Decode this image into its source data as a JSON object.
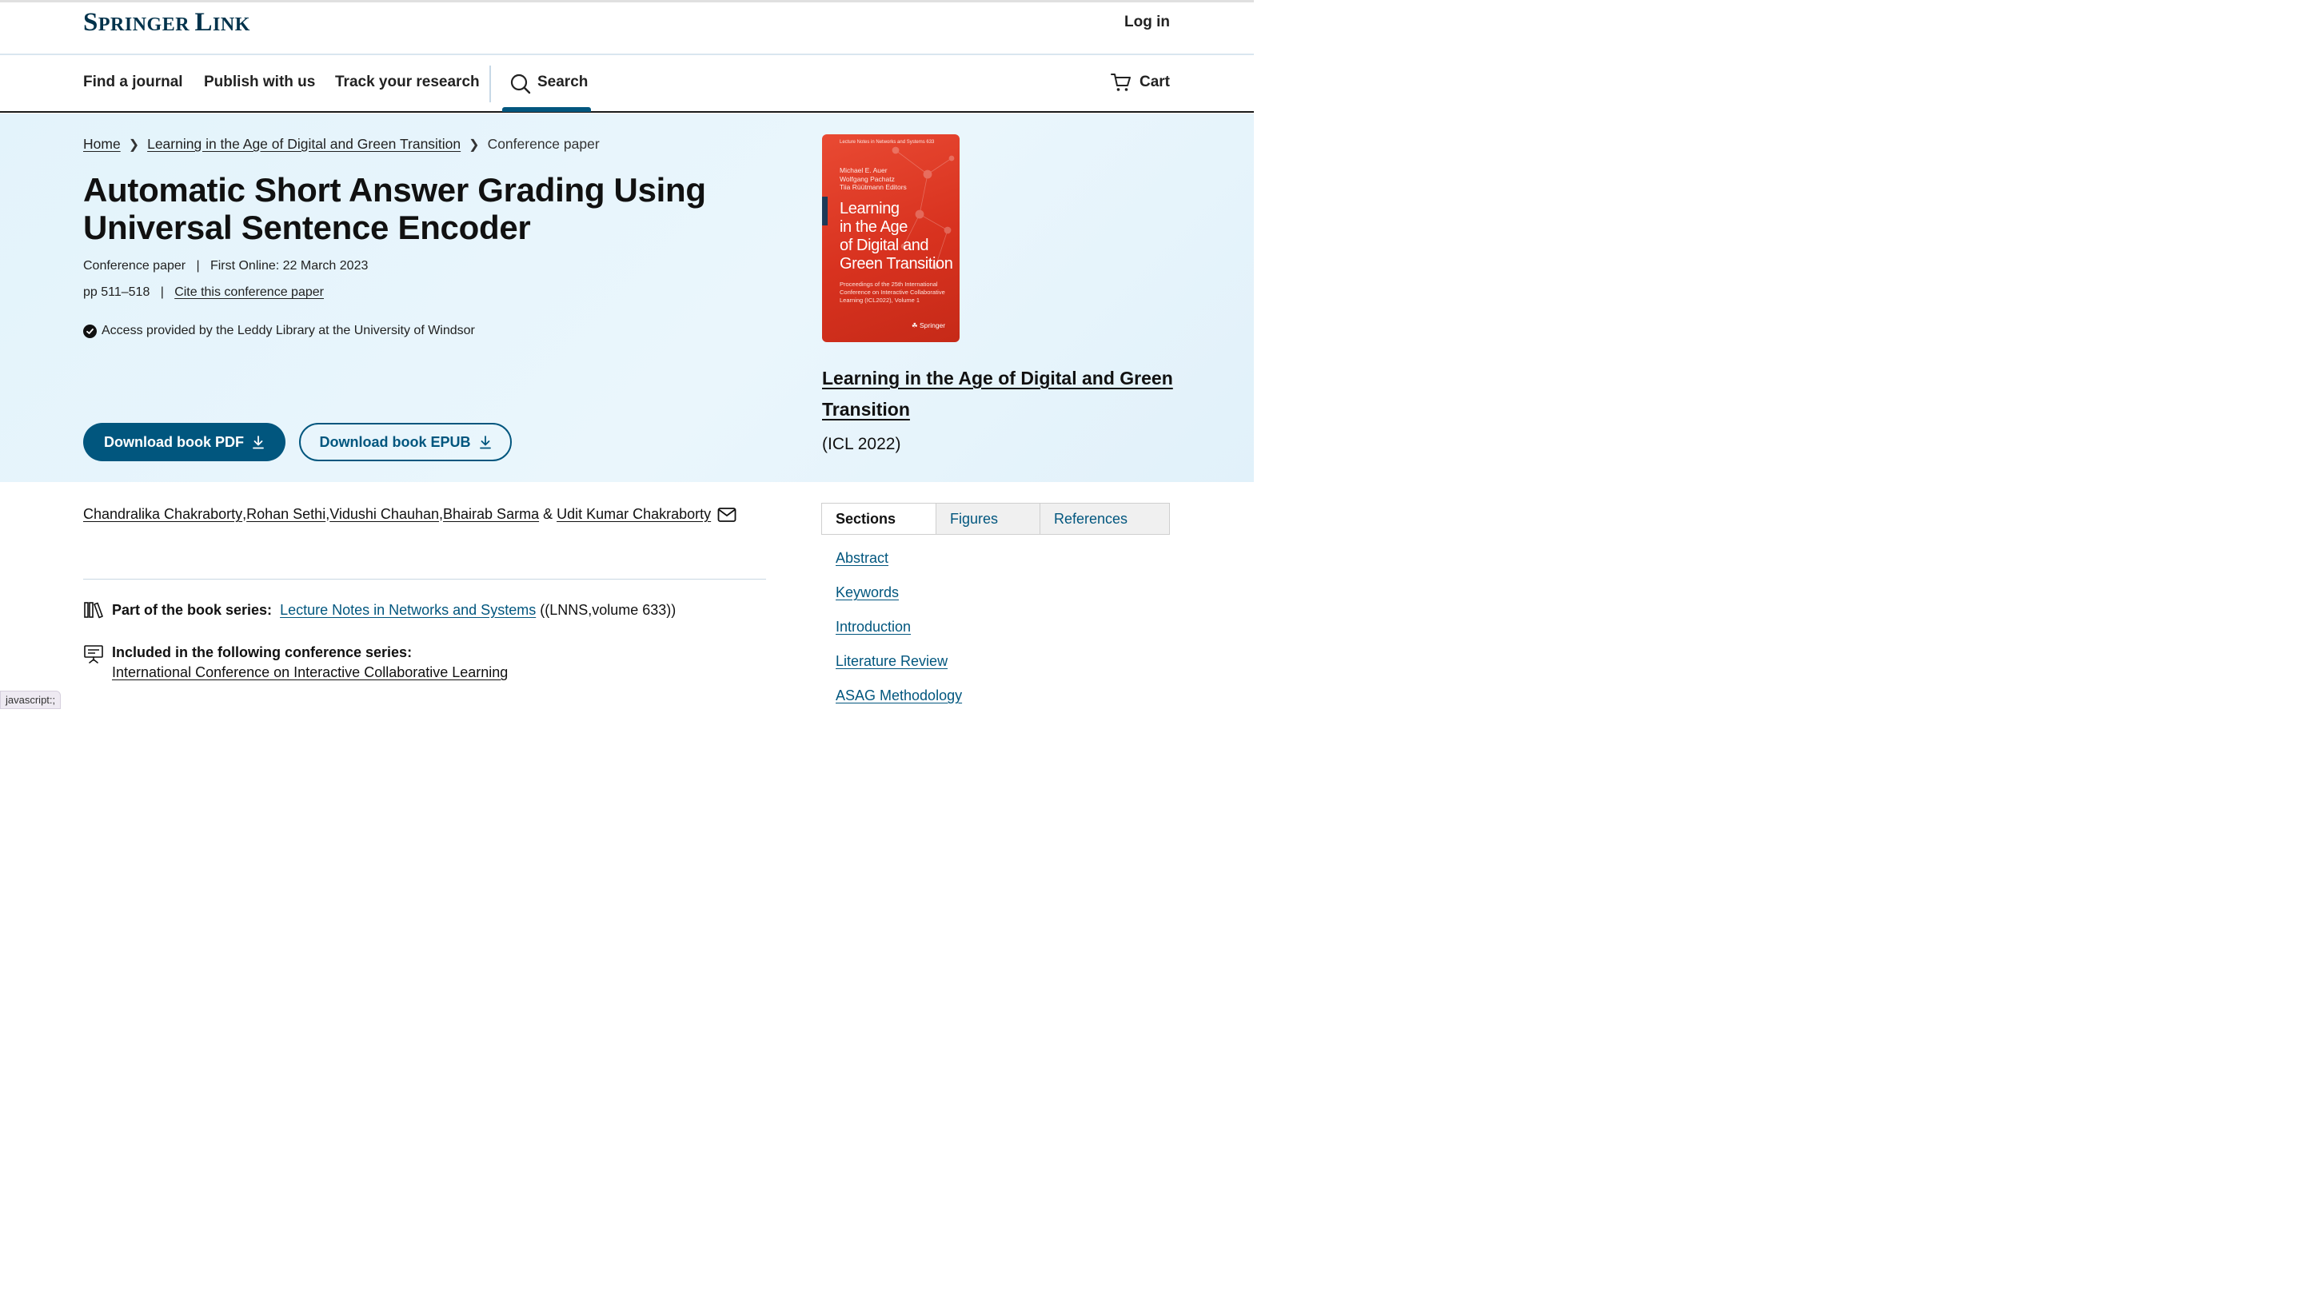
{
  "header": {
    "logo_part1": "S",
    "logo_part2": "PRINGER ",
    "logo_part3": "L",
    "logo_part4": "INK",
    "login": "Log in"
  },
  "nav": {
    "items": [
      "Find a journal",
      "Publish with us",
      "Track your research"
    ],
    "search": "Search",
    "cart": "Cart"
  },
  "breadcrumb": {
    "home": "Home",
    "book": "Learning in the Age of Digital and Green Transition",
    "current": "Conference paper"
  },
  "article": {
    "title": "Automatic Short Answer Grading Using Universal Sentence Encoder",
    "type": "Conference paper",
    "first_online": "First Online: 22 March 2023",
    "pages": "pp 511–518",
    "cite": "Cite this conference paper",
    "access": "Access provided by the Leddy Library at the University of Windsor",
    "download_pdf": "Download book PDF",
    "download_epub": "Download book EPUB"
  },
  "book": {
    "cover_series": "Lecture Notes in Networks and Systems   633",
    "cover_editors": [
      "Michael E. Auer",
      "Wolfgang Pachatz",
      "Tiia Rüütmann  Editors"
    ],
    "cover_title": [
      "Learning",
      "in the Age",
      "of Digital and",
      "Green Transition"
    ],
    "cover_subtitle": "Proceedings of the 25th International Conference on Interactive Collaborative Learning (ICL2022), Volume 1",
    "cover_publisher": "Springer",
    "title": "Learning in the Age of Digital and Green Transition",
    "conference": "(ICL 2022)"
  },
  "authors": {
    "list": [
      "Chandralika Chakraborty",
      "Rohan Sethi",
      "Vidushi Chauhan",
      "Bhairab Sarma",
      "Udit Kumar Chakraborty"
    ],
    "comma": ",",
    "amp": " & "
  },
  "series": {
    "label": "Part of the book series:",
    "link": "Lecture Notes in Networks and Systems",
    "suffix": "((LNNS,volume 633))"
  },
  "conference_series": {
    "label": "Included in the following conference series:",
    "link": "International Conference on Interactive Collaborative Learning"
  },
  "tabs": [
    "Sections",
    "Figures",
    "References"
  ],
  "toc": [
    "Abstract",
    "Keywords",
    "Introduction",
    "Literature Review",
    "ASAG Methodology"
  ],
  "status_bar": "javascript:;",
  "colors": {
    "primary": "#01567e",
    "brand": "#01324b",
    "hero_bg": "#e6f4fb",
    "cover": "#d8321f"
  }
}
